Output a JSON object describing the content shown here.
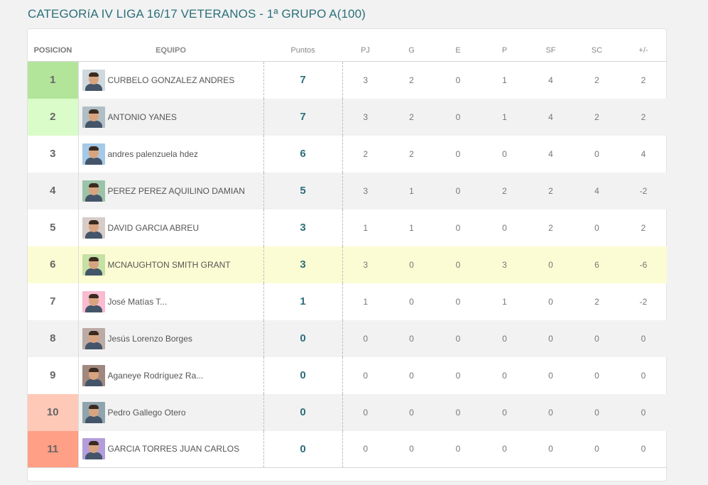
{
  "title": "CATEGORíA IV LIGA 16/17 VETERANOS - 1ª GRUPO A(100)",
  "headers": {
    "pos": "POSICION",
    "team": "EQUIPO",
    "pts": "Puntos",
    "pj": "PJ",
    "g": "G",
    "e": "E",
    "p": "P",
    "sf": "SF",
    "sc": "SC",
    "diff": "+/-"
  },
  "colors": {
    "pos1": "#b2e59a",
    "pos2": "#d9fcc8",
    "pos10": "#ffc9b8",
    "pos11": "#ff9f86",
    "highlight_row": "#fcfcd4",
    "accent": "#2c6f7a"
  },
  "rows": [
    {
      "pos": "1",
      "team": "CURBELO GONZALEZ ANDRES",
      "pts": "7",
      "pj": "3",
      "g": "2",
      "e": "0",
      "p": "1",
      "sf": "4",
      "sc": "2",
      "diff": "2"
    },
    {
      "pos": "2",
      "team": "ANTONIO YANES",
      "pts": "7",
      "pj": "3",
      "g": "2",
      "e": "0",
      "p": "1",
      "sf": "4",
      "sc": "2",
      "diff": "2"
    },
    {
      "pos": "3",
      "team": "andres palenzuela hdez",
      "pts": "6",
      "pj": "2",
      "g": "2",
      "e": "0",
      "p": "0",
      "sf": "4",
      "sc": "0",
      "diff": "4"
    },
    {
      "pos": "4",
      "team": "PEREZ PEREZ AQUILINO DAMIAN",
      "pts": "5",
      "pj": "3",
      "g": "1",
      "e": "0",
      "p": "2",
      "sf": "2",
      "sc": "4",
      "diff": "-2"
    },
    {
      "pos": "5",
      "team": "DAVID GARCIA ABREU",
      "pts": "3",
      "pj": "1",
      "g": "1",
      "e": "0",
      "p": "0",
      "sf": "2",
      "sc": "0",
      "diff": "2"
    },
    {
      "pos": "6",
      "team": "MCNAUGHTON SMITH GRANT",
      "pts": "3",
      "pj": "3",
      "g": "0",
      "e": "0",
      "p": "3",
      "sf": "0",
      "sc": "6",
      "diff": "-6"
    },
    {
      "pos": "7",
      "team": "José Matías T...",
      "pts": "1",
      "pj": "1",
      "g": "0",
      "e": "0",
      "p": "1",
      "sf": "0",
      "sc": "2",
      "diff": "-2"
    },
    {
      "pos": "8",
      "team": "Jesús Lorenzo Borges",
      "pts": "0",
      "pj": "0",
      "g": "0",
      "e": "0",
      "p": "0",
      "sf": "0",
      "sc": "0",
      "diff": "0"
    },
    {
      "pos": "9",
      "team": "Aganeye Rodríguez Ra...",
      "pts": "0",
      "pj": "0",
      "g": "0",
      "e": "0",
      "p": "0",
      "sf": "0",
      "sc": "0",
      "diff": "0"
    },
    {
      "pos": "10",
      "team": "Pedro Gallego Otero",
      "pts": "0",
      "pj": "0",
      "g": "0",
      "e": "0",
      "p": "0",
      "sf": "0",
      "sc": "0",
      "diff": "0"
    },
    {
      "pos": "11",
      "team": "GARCIA TORRES JUAN CARLOS",
      "pts": "0",
      "pj": "0",
      "g": "0",
      "e": "0",
      "p": "0",
      "sf": "0",
      "sc": "0",
      "diff": "0"
    }
  ]
}
